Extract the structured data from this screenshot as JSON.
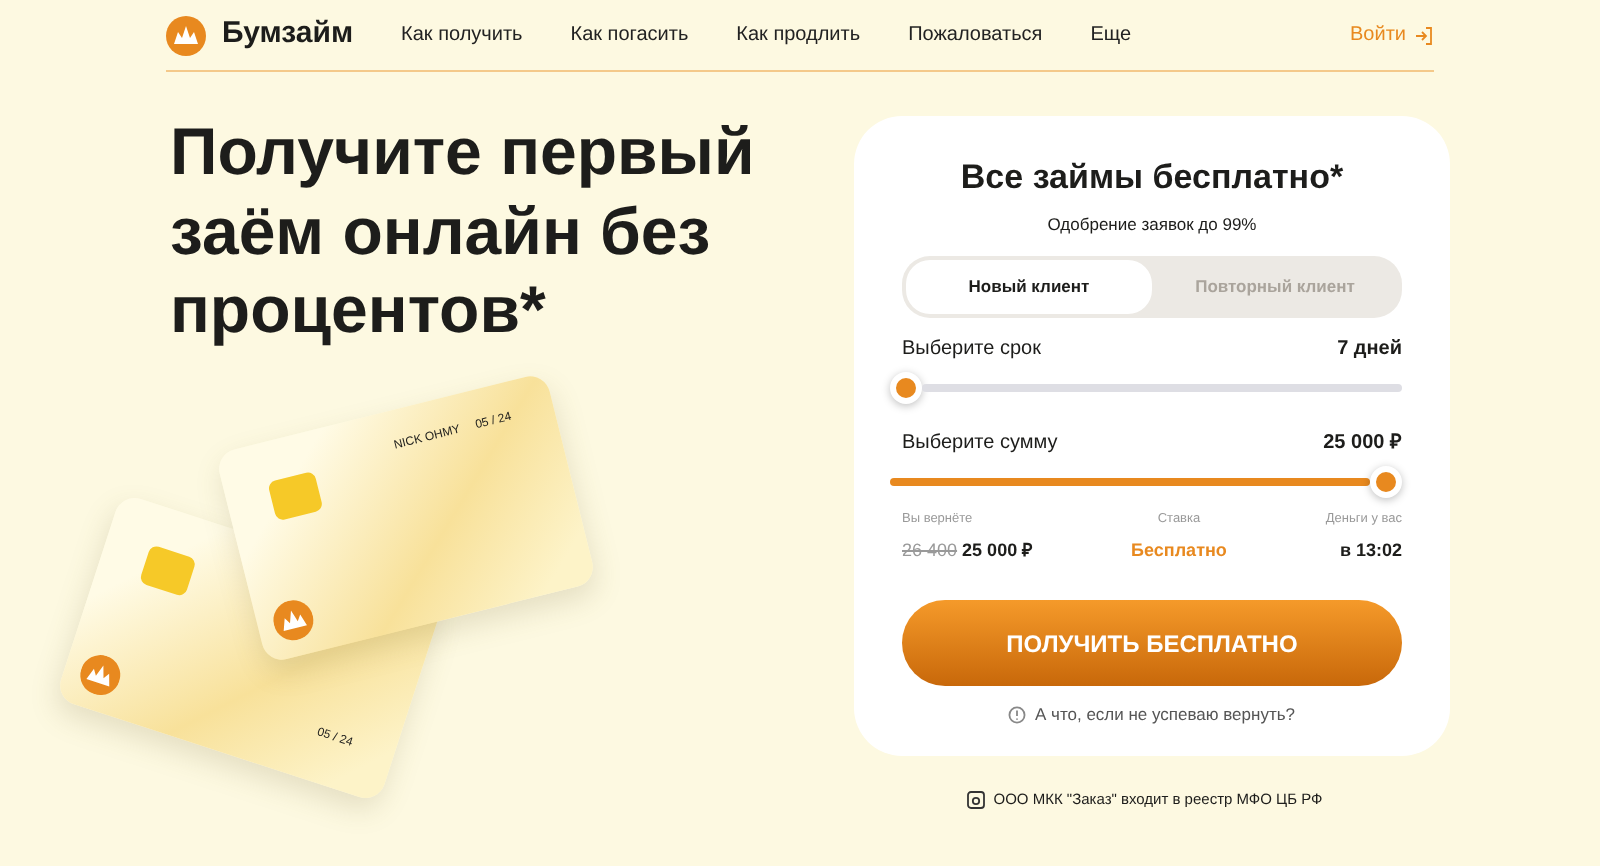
{
  "header": {
    "brand": "Бумзайм",
    "nav": [
      "Как получить",
      "Как погасить",
      "Как продлить",
      "Пожаловаться",
      "Еще"
    ],
    "login": "Войти"
  },
  "hero": {
    "title": "Получите первый заём онлайн без процентов*"
  },
  "cards": [
    {
      "expiry": "05 / 24"
    },
    {
      "name": "NICK OHMY",
      "expiry": "05 / 24"
    }
  ],
  "calculator": {
    "title": "Все займы бесплатно*",
    "subtitle": "Одобрение заявок до 99%",
    "tabs": [
      {
        "label": "Новый клиент",
        "selected": true
      },
      {
        "label": "Повторный клиент",
        "selected": false
      }
    ],
    "sliders": [
      {
        "label": "Выберите срок",
        "reading": "7 дней",
        "level": 0
      },
      {
        "label": "Выберите сумму",
        "reading": "25 000 ₽",
        "level": 1
      }
    ],
    "summary": [
      {
        "label": "Вы вернёте",
        "old": "26 400",
        "value": "25 000 ₽",
        "kind": "amount"
      },
      {
        "label": "Ставка",
        "value": "Бесплатно",
        "kind": "accent"
      },
      {
        "label": "Деньги у вас",
        "value": "в 13:02",
        "kind": "plain"
      }
    ],
    "button": "ПОЛУЧИТЬ БЕСПЛАТНО",
    "help_link": "А что, если не успеваю вернуть?"
  },
  "registry_note": "ООО МКК \"Заказ\" входит в реестр МФО ЦБ РФ"
}
